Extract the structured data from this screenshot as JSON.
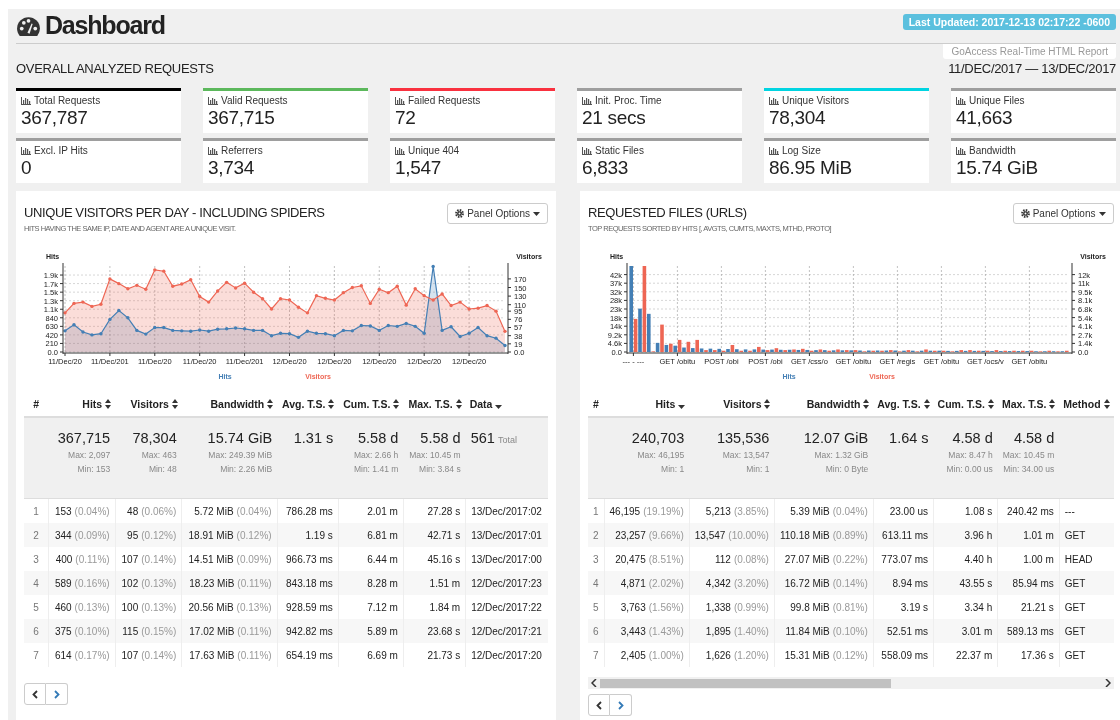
{
  "header": {
    "title": "Dashboard",
    "last_updated": "Last Updated: 2017-12-13 02:17:22 -0600",
    "report_label": "GoAccess Real-Time HTML Report"
  },
  "overview": {
    "title": "OVERALL ANALYZED REQUESTS",
    "date_range": "11/DEC/2017 — 13/DEC/2017"
  },
  "metrics": [
    {
      "label": "Total Requests",
      "value": "367,787",
      "color": "#000000"
    },
    {
      "label": "Valid Requests",
      "value": "367,715",
      "color": "#5cb85c"
    },
    {
      "label": "Failed Requests",
      "value": "72",
      "color": "#f9313f"
    },
    {
      "label": "Init. Proc. Time",
      "value": "21 secs",
      "color": "#9e9e9e"
    },
    {
      "label": "Unique Visitors",
      "value": "78,304",
      "color": "#00d4e1"
    },
    {
      "label": "Unique Files",
      "value": "41,663",
      "color": "#9e9e9e"
    },
    {
      "label": "Excl. IP Hits",
      "value": "0",
      "color": "#9e9e9e"
    },
    {
      "label": "Referrers",
      "value": "3,734",
      "color": "#9e9e9e"
    },
    {
      "label": "Unique 404",
      "value": "1,547",
      "color": "#9e9e9e"
    },
    {
      "label": "Static Files",
      "value": "6,833",
      "color": "#9e9e9e"
    },
    {
      "label": "Log Size",
      "value": "86.95 MiB",
      "color": "#9e9e9e"
    },
    {
      "label": "Bandwidth",
      "value": "15.74 GiB",
      "color": "#9e9e9e"
    }
  ],
  "panels": [
    {
      "title": "UNIQUE VISITORS PER DAY - INCLUDING SPIDERS",
      "subtitle": "HITS HAVING THE SAME IP, DATE AND AGENT ARE A UNIQUE VISIT.",
      "options_label": "Panel Options",
      "scrollable": false,
      "chart_data": {
        "type": "area",
        "grid": true,
        "ylabel": "Hits",
        "y2label": "Visitors",
        "ylim": [
          0,
          2112
        ],
        "y2lim": [
          0,
          200
        ],
        "categories": [
          "11/Dec/20",
          null,
          null,
          null,
          null,
          "11/Dec/201",
          null,
          null,
          null,
          null,
          "11/Dec/20",
          null,
          null,
          null,
          null,
          "11/Dec/20",
          null,
          null,
          null,
          null,
          "11/Dec/201",
          null,
          null,
          null,
          null,
          "12/Dec/20",
          null,
          null,
          null,
          null,
          "12/Dec/20",
          null,
          null,
          null,
          null,
          "12/Dec/20",
          null,
          null,
          null,
          null,
          "12/Dec/20",
          null,
          null,
          null,
          null,
          "12/Dec/20",
          null,
          null,
          null,
          null
        ],
        "yticks": [
          {
            "value": 0,
            "label": "0.0"
          },
          210,
          420,
          630,
          840,
          {
            "value": 1050,
            "label": "1.1k"
          },
          {
            "value": 1260,
            "label": "1.3k"
          },
          {
            "value": 1470,
            "label": "1.5k"
          },
          {
            "value": 1680,
            "label": "1.7k"
          },
          {
            "value": 1890,
            "label": "1.9k"
          }
        ],
        "y2ticks": [
          {
            "value": 0,
            "label": "0.0"
          },
          19,
          38,
          57,
          76,
          95,
          110,
          130,
          150,
          170
        ],
        "series": [
          {
            "name": "Hits",
            "color": "#447fb5",
            "values": [
              520,
              670,
              490,
              420,
              450,
              800,
              1020,
              840,
              530,
              440,
              600,
              600,
              530,
              520,
              510,
              540,
              510,
              560,
              570,
              590,
              570,
              530,
              530,
              400,
              460,
              450,
              360,
              510,
              460,
              450,
              400,
              530,
              520,
              650,
              640,
              530,
              650,
              630,
              700,
              630,
              460,
              2100,
              530,
              620,
              380,
              460,
              600,
              400,
              340,
              160
            ]
          },
          {
            "name": "Visitors",
            "color": "#ee6654",
            "axis": "y2",
            "values": [
              91,
              113,
              116,
              106,
              111,
              170,
              159,
              147,
              155,
              146,
              191,
              188,
              153,
              158,
              168,
              129,
              116,
              142,
              162,
              149,
              160,
              139,
              124,
              100,
              124,
              121,
              104,
              91,
              131,
              125,
              121,
              138,
              150,
              154,
              113,
              146,
              138,
              153,
              109,
              147,
              131,
              121,
              135,
              108,
              116,
              100,
              102,
              108,
              95,
              48
            ]
          }
        ]
      },
      "table": {
        "columns": [
          {
            "label": "#"
          },
          {
            "label": "Hits",
            "sorted": false
          },
          {
            "label": "Visitors",
            "sorted": false
          },
          {
            "label": "Bandwidth",
            "sorted": false
          },
          {
            "label": "Avg. T.S.",
            "sorted": false
          },
          {
            "label": "Cum. T.S.",
            "sorted": false
          },
          {
            "label": "Max. T.S.",
            "sorted": false
          },
          {
            "label": "Data",
            "sorted": true
          }
        ],
        "summary": [
          {
            "value": "367,715",
            "max": "Max: 2,097",
            "min": "Min: 153"
          },
          {
            "value": "78,304",
            "max": "Max: 463",
            "min": "Min: 48"
          },
          {
            "value": "15.74 GiB",
            "max": "Max: 249.39 MiB",
            "min": "Min: 2.26 MiB"
          },
          {
            "value": "1.31 s"
          },
          {
            "value": "5.58 d",
            "max": "Max: 2.66 h",
            "min": "Min: 1.41 m"
          },
          {
            "value": "5.58 d",
            "max": "Max: 10.45 m",
            "min": "Min: 3.84 s"
          },
          {
            "value": "561",
            "note": "Total"
          }
        ],
        "rows": [
          {
            "cells": [
              [
                "1"
              ],
              [
                "153",
                "(0.04%)"
              ],
              [
                "48",
                "(0.06%)"
              ],
              [
                "5.72 MiB",
                "(0.04%)"
              ],
              [
                "786.28 ms"
              ],
              [
                "2.01 m"
              ],
              [
                "27.28 s"
              ],
              [
                "13/Dec/2017:02"
              ]
            ]
          },
          {
            "cells": [
              [
                "2"
              ],
              [
                "344",
                "(0.09%)"
              ],
              [
                "95",
                "(0.12%)"
              ],
              [
                "18.91 MiB",
                "(0.12%)"
              ],
              [
                "1.19 s"
              ],
              [
                "6.81 m"
              ],
              [
                "42.71 s"
              ],
              [
                "13/Dec/2017:01"
              ]
            ]
          },
          {
            "cells": [
              [
                "3"
              ],
              [
                "400",
                "(0.11%)"
              ],
              [
                "107",
                "(0.14%)"
              ],
              [
                "14.51 MiB",
                "(0.09%)"
              ],
              [
                "966.73 ms"
              ],
              [
                "6.44 m"
              ],
              [
                "45.16 s"
              ],
              [
                "13/Dec/2017:00"
              ]
            ]
          },
          {
            "cells": [
              [
                "4"
              ],
              [
                "589",
                "(0.16%)"
              ],
              [
                "102",
                "(0.13%)"
              ],
              [
                "18.23 MiB",
                "(0.11%)"
              ],
              [
                "843.18 ms"
              ],
              [
                "8.28 m"
              ],
              [
                "1.51 m"
              ],
              [
                "12/Dec/2017:23"
              ]
            ]
          },
          {
            "cells": [
              [
                "5"
              ],
              [
                "460",
                "(0.13%)"
              ],
              [
                "100",
                "(0.13%)"
              ],
              [
                "20.56 MiB",
                "(0.13%)"
              ],
              [
                "928.59 ms"
              ],
              [
                "7.12 m"
              ],
              [
                "1.84 m"
              ],
              [
                "12/Dec/2017:22"
              ]
            ]
          },
          {
            "cells": [
              [
                "6"
              ],
              [
                "375",
                "(0.10%)"
              ],
              [
                "115",
                "(0.15%)"
              ],
              [
                "17.02 MiB",
                "(0.11%)"
              ],
              [
                "942.82 ms"
              ],
              [
                "5.89 m"
              ],
              [
                "23.68 s"
              ],
              [
                "12/Dec/2017:21"
              ]
            ]
          },
          {
            "cells": [
              [
                "7"
              ],
              [
                "614",
                "(0.17%)"
              ],
              [
                "107",
                "(0.14%)"
              ],
              [
                "17.63 MiB",
                "(0.11%)"
              ],
              [
                "654.19 ms"
              ],
              [
                "6.69 m"
              ],
              [
                "21.73 s"
              ],
              [
                "12/Dec/2017:20"
              ]
            ]
          }
        ]
      }
    },
    {
      "title": "REQUESTED FILES (URLS)",
      "subtitle": "TOP REQUESTS SORTED BY HITS [, AVGTS, CUMTS, MAXTS, MTHD, PROTO]",
      "options_label": "Panel Options",
      "scrollable": true,
      "chart_data": {
        "type": "bar",
        "grid": true,
        "ylabel": "Hits",
        "y2label": "Visitors",
        "ylim": [
          0,
          46200
        ],
        "y2lim": [
          0,
          13500
        ],
        "categories": [
          "--- - ---",
          null,
          null,
          null,
          null,
          "GET /obitu",
          null,
          null,
          null,
          null,
          "POST /obi",
          null,
          null,
          null,
          null,
          "POST /obi",
          null,
          null,
          null,
          null,
          "GET /css/o",
          null,
          null,
          null,
          null,
          "GET /obitu",
          null,
          null,
          null,
          null,
          "GET /regis",
          null,
          null,
          null,
          null,
          "GET /obitu",
          null,
          null,
          null,
          null,
          "GET /ocs/v",
          null,
          null,
          null,
          null,
          "GET /obitu",
          null,
          null,
          null,
          null
        ],
        "yticks": [
          {
            "value": 0,
            "label": "0.0"
          },
          {
            "value": 4620,
            "label": "4.6k"
          },
          {
            "value": 9240,
            "label": "9.2k"
          },
          {
            "value": 13860,
            "label": "14k"
          },
          {
            "value": 18480,
            "label": "18k"
          },
          {
            "value": 23100,
            "label": "23k"
          },
          {
            "value": 27720,
            "label": "28k"
          },
          {
            "value": 32340,
            "label": "32k"
          },
          {
            "value": 36960,
            "label": "37k"
          },
          {
            "value": 41580,
            "label": "42k"
          }
        ],
        "y2ticks": [
          {
            "value": 0,
            "label": "0.0"
          },
          {
            "value": 1350,
            "label": "1.4k"
          },
          {
            "value": 2700,
            "label": "2.7k"
          },
          {
            "value": 4050,
            "label": "4.1k"
          },
          {
            "value": 5400,
            "label": "5.4k"
          },
          {
            "value": 6750,
            "label": "6.8k"
          },
          {
            "value": 8100,
            "label": "8.1k"
          },
          {
            "value": 9450,
            "label": "9.5k"
          },
          {
            "value": 10800,
            "label": "11k"
          },
          {
            "value": 12150,
            "label": "12k"
          }
        ],
        "series": [
          {
            "name": "Hits",
            "color": "#447fb5",
            "values": [
              46200,
              23300,
              20500,
              4900,
              3800,
              3400,
              2400,
              2100,
              1900,
              1800,
              1700,
              1600,
              1500,
              1400,
              1400,
              1300,
              1300,
              1200,
              1200,
              1100,
              1100,
              1000,
              1000,
              900,
              900,
              900,
              800,
              800,
              800,
              800,
              800,
              700,
              700,
              700,
              700,
              700,
              600,
              600,
              600,
              600,
              600,
              500,
              500,
              500,
              500,
              500,
              400,
              400,
              400,
              400
            ]
          },
          {
            "name": "Visitors",
            "color": "#ee6654",
            "axis": "y2",
            "values": [
              5200,
              13500,
              100,
              4300,
              1300,
              1900,
              1600,
              1900,
              300,
              300,
              200,
              1100,
              200,
              200,
              800,
              300,
              600,
              300,
              400,
              500,
              200,
              400,
              200,
              400,
              300,
              300,
              100,
              200,
              200,
              300,
              100,
              300,
              100,
              400,
              200,
              200,
              100,
              300,
              300,
              200,
              200,
              300,
              200,
              200,
              200,
              200,
              100,
              200,
              100,
              200
            ]
          }
        ]
      },
      "table": {
        "columns": [
          {
            "label": "#"
          },
          {
            "label": "Hits",
            "sorted": true
          },
          {
            "label": "Visitors",
            "sorted": false
          },
          {
            "label": "Bandwidth",
            "sorted": false
          },
          {
            "label": "Avg. T.S.",
            "sorted": false
          },
          {
            "label": "Cum. T.S.",
            "sorted": false
          },
          {
            "label": "Max. T.S.",
            "sorted": false
          },
          {
            "label": "Method",
            "sorted": false
          }
        ],
        "summary": [
          {
            "value": "240,703",
            "max": "Max: 46,195",
            "min": "Min: 1"
          },
          {
            "value": "135,536",
            "max": "Max: 13,547",
            "min": "Min: 1"
          },
          {
            "value": "12.07 GiB",
            "max": "Max: 1.32 GiB",
            "min": "Min: 0 Byte"
          },
          {
            "value": "1.64 s"
          },
          {
            "value": "4.58 d",
            "max": "Max: 8.47 h",
            "min": "Min: 0.00 us"
          },
          {
            "value": "4.58 d",
            "max": "Max: 10.45 m",
            "min": "Min: 34.00 us"
          }
        ],
        "rows": [
          {
            "cells": [
              [
                "1"
              ],
              [
                "46,195",
                "(19.19%)"
              ],
              [
                "5,213",
                "(3.85%)"
              ],
              [
                "5.39 MiB",
                "(0.04%)"
              ],
              [
                "23.00 us"
              ],
              [
                "1.08 s"
              ],
              [
                "240.42 ms"
              ],
              [
                "---"
              ]
            ]
          },
          {
            "cells": [
              [
                "2"
              ],
              [
                "23,257",
                "(9.66%)"
              ],
              [
                "13,547",
                "(10.00%)"
              ],
              [
                "110.18 MiB",
                "(0.89%)"
              ],
              [
                "613.11 ms"
              ],
              [
                "3.96 h"
              ],
              [
                "1.01 m"
              ],
              [
                "GET"
              ]
            ]
          },
          {
            "cells": [
              [
                "3"
              ],
              [
                "20,475",
                "(8.51%)"
              ],
              [
                "112",
                "(0.08%)"
              ],
              [
                "27.07 MiB",
                "(0.22%)"
              ],
              [
                "773.07 ms"
              ],
              [
                "4.40 h"
              ],
              [
                "1.00 m"
              ],
              [
                "HEAD"
              ]
            ]
          },
          {
            "cells": [
              [
                "4"
              ],
              [
                "4,871",
                "(2.02%)"
              ],
              [
                "4,342",
                "(3.20%)"
              ],
              [
                "16.72 MiB",
                "(0.14%)"
              ],
              [
                "8.94 ms"
              ],
              [
                "43.55 s"
              ],
              [
                "85.94 ms"
              ],
              [
                "GET"
              ]
            ]
          },
          {
            "cells": [
              [
                "5"
              ],
              [
                "3,763",
                "(1.56%)"
              ],
              [
                "1,338",
                "(0.99%)"
              ],
              [
                "99.8 MiB",
                "(0.81%)"
              ],
              [
                "3.19 s"
              ],
              [
                "3.34 h"
              ],
              [
                "21.21 s"
              ],
              [
                "GET"
              ]
            ]
          },
          {
            "cells": [
              [
                "6"
              ],
              [
                "3,443",
                "(1.43%)"
              ],
              [
                "1,895",
                "(1.40%)"
              ],
              [
                "11.84 MiB",
                "(0.10%)"
              ],
              [
                "52.51 ms"
              ],
              [
                "3.01 m"
              ],
              [
                "589.13 ms"
              ],
              [
                "GET"
              ]
            ]
          },
          {
            "cells": [
              [
                "7"
              ],
              [
                "2,405",
                "(1.00%)"
              ],
              [
                "1,626",
                "(1.20%)"
              ],
              [
                "15.31 MiB",
                "(0.12%)"
              ],
              [
                "558.09 ms"
              ],
              [
                "22.37 m"
              ],
              [
                "17.36 s"
              ],
              [
                "GET"
              ]
            ]
          }
        ]
      }
    }
  ]
}
